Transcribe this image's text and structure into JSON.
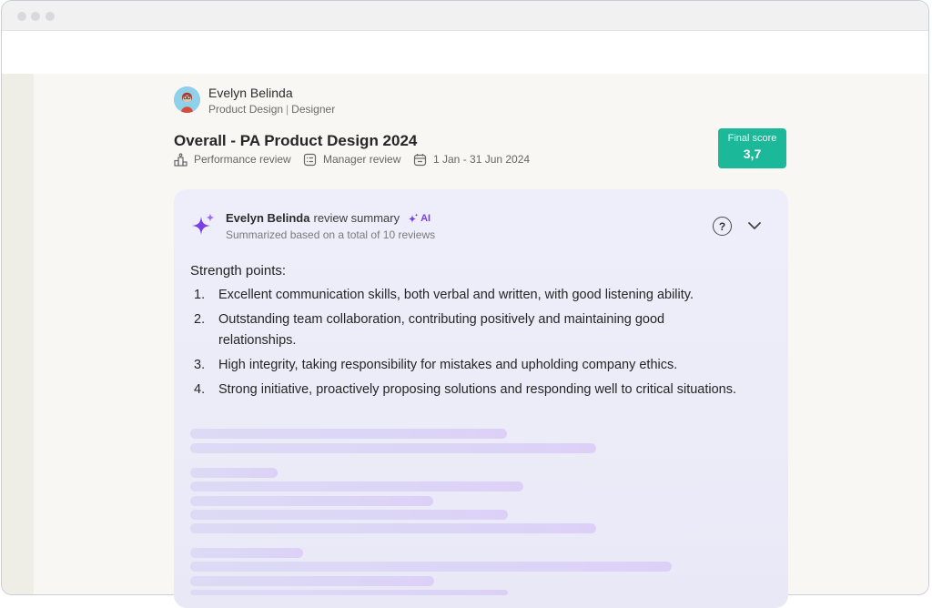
{
  "user": {
    "name": "Evelyn Belinda",
    "department": "Product Design",
    "separator": "|",
    "role": "Designer"
  },
  "review": {
    "title": "Overall - PA Product Design 2024",
    "type": "Performance review",
    "reviewer": "Manager review",
    "period": "1 Jan - 31 Jun 2024"
  },
  "score": {
    "label": "Final score",
    "value": "3,7"
  },
  "summary": {
    "name": "Evelyn Belinda",
    "title_suffix": "review summary",
    "ai_label": "AI",
    "subtitle": "Summarized based on a total of 10 reviews",
    "help_label": "?",
    "strength_title": "Strength points:",
    "points": [
      {
        "num": "1.",
        "text": "Excellent communication skills, both verbal and written, with good listening ability."
      },
      {
        "num": "2.",
        "text": "Outstanding team collaboration, contributing positively and maintaining good relationships."
      },
      {
        "num": "3.",
        "text": "High integrity, taking responsibility for mistakes and upholding company ethics."
      },
      {
        "num": "4.",
        "text": "Strong initiative, proactively proposing solutions and responding well to critical situations."
      }
    ]
  },
  "icons": {
    "type": "podium-icon",
    "reviewer": "form-icon",
    "period": "calendar-icon",
    "summary": "sparkle-icon",
    "ai": "sparkle-small-icon",
    "help": "help-icon",
    "collapse": "chevron-down-icon"
  },
  "colors": {
    "accent": "#1bb89a",
    "ai": "#7b3fe4",
    "card_bg": "#ececf8",
    "skeleton": "#dcd8f5"
  }
}
